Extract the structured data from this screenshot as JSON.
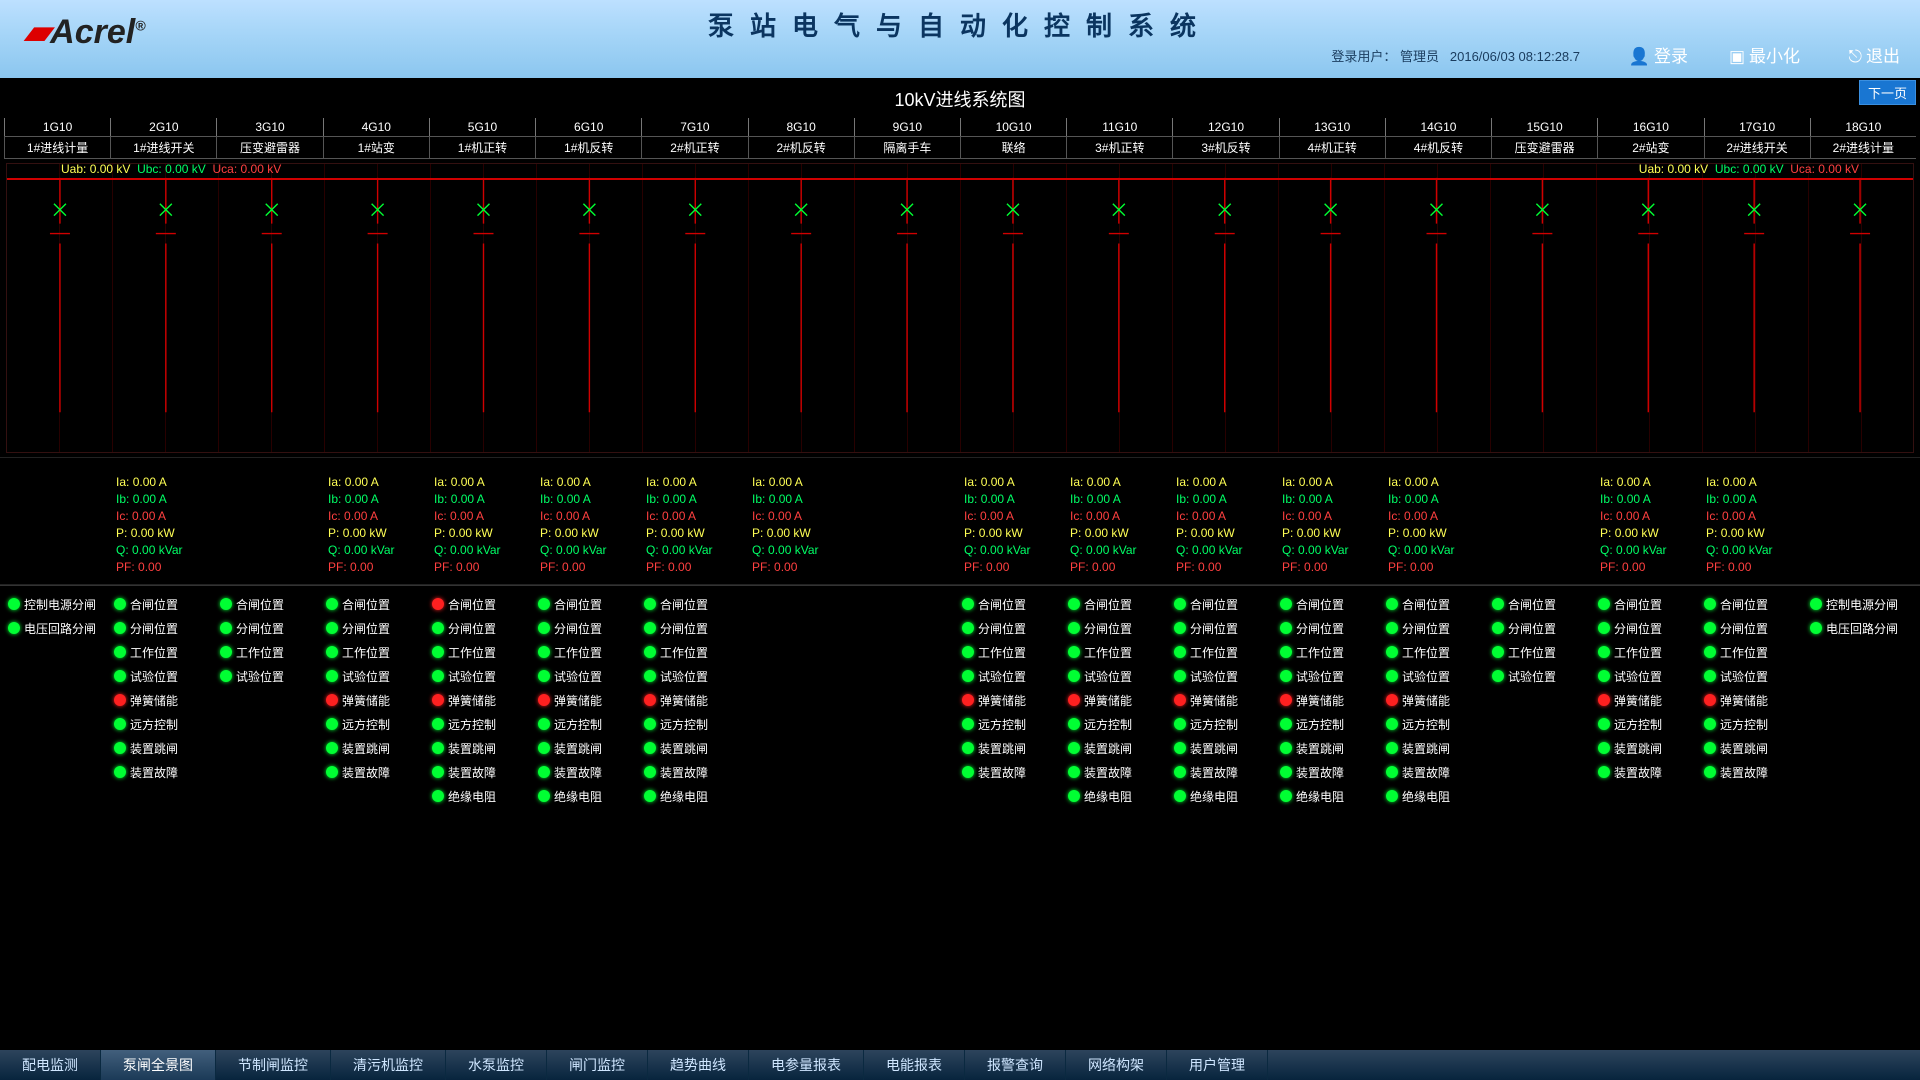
{
  "header": {
    "logo_text": "Acrel",
    "logo_mark": "®",
    "system_title": "泵站电气与自动化控制系统",
    "user_label": "登录用户：",
    "user_name": "管理员",
    "datetime": "2016/06/03  08:12:28.7",
    "login_btn": "登录",
    "minimize_btn": "最小化",
    "exit_btn": "退出",
    "next_page": "下一页"
  },
  "page_title": "10kV进线系统图",
  "columns": [
    {
      "g": "1G10",
      "n": "1#进线计量"
    },
    {
      "g": "2G10",
      "n": "1#进线开关"
    },
    {
      "g": "3G10",
      "n": "压变避雷器"
    },
    {
      "g": "4G10",
      "n": "1#站变"
    },
    {
      "g": "5G10",
      "n": "1#机正转"
    },
    {
      "g": "6G10",
      "n": "1#机反转"
    },
    {
      "g": "7G10",
      "n": "2#机正转"
    },
    {
      "g": "8G10",
      "n": "2#机反转"
    },
    {
      "g": "9G10",
      "n": "隔离手车"
    },
    {
      "g": "10G10",
      "n": "联络"
    },
    {
      "g": "11G10",
      "n": "3#机正转"
    },
    {
      "g": "12G10",
      "n": "3#机反转"
    },
    {
      "g": "13G10",
      "n": "4#机正转"
    },
    {
      "g": "14G10",
      "n": "4#机反转"
    },
    {
      "g": "15G10",
      "n": "压变避雷器"
    },
    {
      "g": "16G10",
      "n": "2#站变"
    },
    {
      "g": "17G10",
      "n": "2#进线开关"
    },
    {
      "g": "18G10",
      "n": "2#进线计量"
    }
  ],
  "voltage_left": {
    "uab_l": "Uab:",
    "uab_v": "0.00 kV",
    "ubc_l": "Ubc:",
    "ubc_v": "0.00 kV",
    "uca_l": "Uca:",
    "uca_v": "0.00 kV"
  },
  "voltage_right": {
    "uab_l": "Uab:",
    "uab_v": "0.00 kV",
    "ubc_l": "Ubc:",
    "ubc_v": "0.00 kV",
    "uca_l": "Uca:",
    "uca_v": "0.00 kV"
  },
  "meas_labels": {
    "Ia": "Ia:",
    "Ib": "Ib:",
    "Ic": "Ic:",
    "P": "P:",
    "Q": "Q:",
    "PF": "PF:",
    "A": "0.00  A",
    "kW": "0.00  kW",
    "kVar": "0.00  kVar",
    "pf": "0.00"
  },
  "meas_cols": [
    2,
    4,
    5,
    6,
    7,
    8,
    10,
    11,
    12,
    13,
    14,
    16,
    17
  ],
  "status_labels": {
    "ctrl_power": "控制电源分闸",
    "volt_loop": "电压回路分闸",
    "close_pos": "合闸位置",
    "open_pos": "分闸位置",
    "work_pos": "工作位置",
    "test_pos": "试验位置",
    "spring": "弹簧储能",
    "remote": "远方控制",
    "trip": "装置跳闸",
    "fault": "装置故障",
    "insul": "绝缘电阻"
  },
  "status_cols": [
    {
      "type": "pt",
      "items": [
        {
          "k": "ctrl_power",
          "c": "g"
        },
        {
          "k": "volt_loop",
          "c": "g"
        }
      ]
    },
    {
      "type": "sw",
      "items": [
        {
          "k": "close_pos",
          "c": "g"
        },
        {
          "k": "open_pos",
          "c": "g"
        },
        {
          "k": "work_pos",
          "c": "g"
        },
        {
          "k": "test_pos",
          "c": "g"
        },
        {
          "k": "spring",
          "c": "r"
        },
        {
          "k": "remote",
          "c": "g"
        },
        {
          "k": "trip",
          "c": "g"
        },
        {
          "k": "fault",
          "c": "g"
        }
      ]
    },
    {
      "type": "sw",
      "items": [
        {
          "k": "close_pos",
          "c": "g"
        },
        {
          "k": "open_pos",
          "c": "g"
        },
        {
          "k": "work_pos",
          "c": "g"
        },
        {
          "k": "test_pos",
          "c": "g"
        }
      ]
    },
    {
      "type": "sw",
      "items": [
        {
          "k": "close_pos",
          "c": "g"
        },
        {
          "k": "open_pos",
          "c": "g"
        },
        {
          "k": "work_pos",
          "c": "g"
        },
        {
          "k": "test_pos",
          "c": "g"
        },
        {
          "k": "spring",
          "c": "r"
        },
        {
          "k": "remote",
          "c": "g"
        },
        {
          "k": "trip",
          "c": "g"
        },
        {
          "k": "fault",
          "c": "g"
        }
      ]
    },
    {
      "type": "mot",
      "items": [
        {
          "k": "close_pos",
          "c": "r"
        },
        {
          "k": "open_pos",
          "c": "g"
        },
        {
          "k": "work_pos",
          "c": "g"
        },
        {
          "k": "test_pos",
          "c": "g"
        },
        {
          "k": "spring",
          "c": "r"
        },
        {
          "k": "remote",
          "c": "g"
        },
        {
          "k": "trip",
          "c": "g"
        },
        {
          "k": "fault",
          "c": "g"
        },
        {
          "k": "insul",
          "c": "g"
        }
      ]
    },
    {
      "type": "mot",
      "items": [
        {
          "k": "close_pos",
          "c": "g"
        },
        {
          "k": "open_pos",
          "c": "g"
        },
        {
          "k": "work_pos",
          "c": "g"
        },
        {
          "k": "test_pos",
          "c": "g"
        },
        {
          "k": "spring",
          "c": "r"
        },
        {
          "k": "remote",
          "c": "g"
        },
        {
          "k": "trip",
          "c": "g"
        },
        {
          "k": "fault",
          "c": "g"
        },
        {
          "k": "insul",
          "c": "g"
        }
      ]
    },
    {
      "type": "mot",
      "items": [
        {
          "k": "close_pos",
          "c": "g"
        },
        {
          "k": "open_pos",
          "c": "g"
        },
        {
          "k": "work_pos",
          "c": "g"
        },
        {
          "k": "test_pos",
          "c": "g"
        },
        {
          "k": "spring",
          "c": "r"
        },
        {
          "k": "remote",
          "c": "g"
        },
        {
          "k": "trip",
          "c": "g"
        },
        {
          "k": "fault",
          "c": "g"
        },
        {
          "k": "insul",
          "c": "g"
        }
      ]
    },
    {
      "type": "empty",
      "items": []
    },
    {
      "type": "tie",
      "items": [
        {
          "k": "close_pos",
          "c": "g"
        },
        {
          "k": "open_pos",
          "c": "g"
        },
        {
          "k": "work_pos",
          "c": "g"
        },
        {
          "k": "test_pos",
          "c": "g"
        },
        {
          "k": "spring",
          "c": "r"
        },
        {
          "k": "remote",
          "c": "g"
        },
        {
          "k": "trip",
          "c": "g"
        },
        {
          "k": "fault",
          "c": "g"
        }
      ]
    },
    {
      "type": "mot",
      "items": [
        {
          "k": "close_pos",
          "c": "g"
        },
        {
          "k": "open_pos",
          "c": "g"
        },
        {
          "k": "work_pos",
          "c": "g"
        },
        {
          "k": "test_pos",
          "c": "g"
        },
        {
          "k": "spring",
          "c": "r"
        },
        {
          "k": "remote",
          "c": "g"
        },
        {
          "k": "trip",
          "c": "g"
        },
        {
          "k": "fault",
          "c": "g"
        },
        {
          "k": "insul",
          "c": "g"
        }
      ]
    },
    {
      "type": "mot",
      "items": [
        {
          "k": "close_pos",
          "c": "g"
        },
        {
          "k": "open_pos",
          "c": "g"
        },
        {
          "k": "work_pos",
          "c": "g"
        },
        {
          "k": "test_pos",
          "c": "g"
        },
        {
          "k": "spring",
          "c": "r"
        },
        {
          "k": "remote",
          "c": "g"
        },
        {
          "k": "trip",
          "c": "g"
        },
        {
          "k": "fault",
          "c": "g"
        },
        {
          "k": "insul",
          "c": "g"
        }
      ]
    },
    {
      "type": "mot",
      "items": [
        {
          "k": "close_pos",
          "c": "g"
        },
        {
          "k": "open_pos",
          "c": "g"
        },
        {
          "k": "work_pos",
          "c": "g"
        },
        {
          "k": "test_pos",
          "c": "g"
        },
        {
          "k": "spring",
          "c": "r"
        },
        {
          "k": "remote",
          "c": "g"
        },
        {
          "k": "trip",
          "c": "g"
        },
        {
          "k": "fault",
          "c": "g"
        },
        {
          "k": "insul",
          "c": "g"
        }
      ]
    },
    {
      "type": "mot",
      "items": [
        {
          "k": "close_pos",
          "c": "g"
        },
        {
          "k": "open_pos",
          "c": "g"
        },
        {
          "k": "work_pos",
          "c": "g"
        },
        {
          "k": "test_pos",
          "c": "g"
        },
        {
          "k": "spring",
          "c": "r"
        },
        {
          "k": "remote",
          "c": "g"
        },
        {
          "k": "trip",
          "c": "g"
        },
        {
          "k": "fault",
          "c": "g"
        },
        {
          "k": "insul",
          "c": "g"
        }
      ]
    },
    {
      "type": "sw",
      "items": [
        {
          "k": "close_pos",
          "c": "g"
        },
        {
          "k": "open_pos",
          "c": "g"
        },
        {
          "k": "work_pos",
          "c": "g"
        },
        {
          "k": "test_pos",
          "c": "g"
        }
      ]
    },
    {
      "type": "sw",
      "items": [
        {
          "k": "close_pos",
          "c": "g"
        },
        {
          "k": "open_pos",
          "c": "g"
        },
        {
          "k": "work_pos",
          "c": "g"
        },
        {
          "k": "test_pos",
          "c": "g"
        },
        {
          "k": "spring",
          "c": "r"
        },
        {
          "k": "remote",
          "c": "g"
        },
        {
          "k": "trip",
          "c": "g"
        },
        {
          "k": "fault",
          "c": "g"
        }
      ]
    },
    {
      "type": "sw",
      "items": [
        {
          "k": "close_pos",
          "c": "g"
        },
        {
          "k": "open_pos",
          "c": "g"
        },
        {
          "k": "work_pos",
          "c": "g"
        },
        {
          "k": "test_pos",
          "c": "g"
        },
        {
          "k": "spring",
          "c": "r"
        },
        {
          "k": "remote",
          "c": "g"
        },
        {
          "k": "trip",
          "c": "g"
        },
        {
          "k": "fault",
          "c": "g"
        }
      ]
    },
    {
      "type": "pt",
      "items": [
        {
          "k": "ctrl_power",
          "c": "g"
        },
        {
          "k": "volt_loop",
          "c": "g"
        }
      ]
    }
  ],
  "bottom_tabs": [
    "配电监测",
    "泵闸全景图",
    "节制闸监控",
    "清污机监控",
    "水泵监控",
    "闸门监控",
    "趋势曲线",
    "电参量报表",
    "电能报表",
    "报警查询",
    "网络构架",
    "用户管理"
  ],
  "bottom_active": 1
}
